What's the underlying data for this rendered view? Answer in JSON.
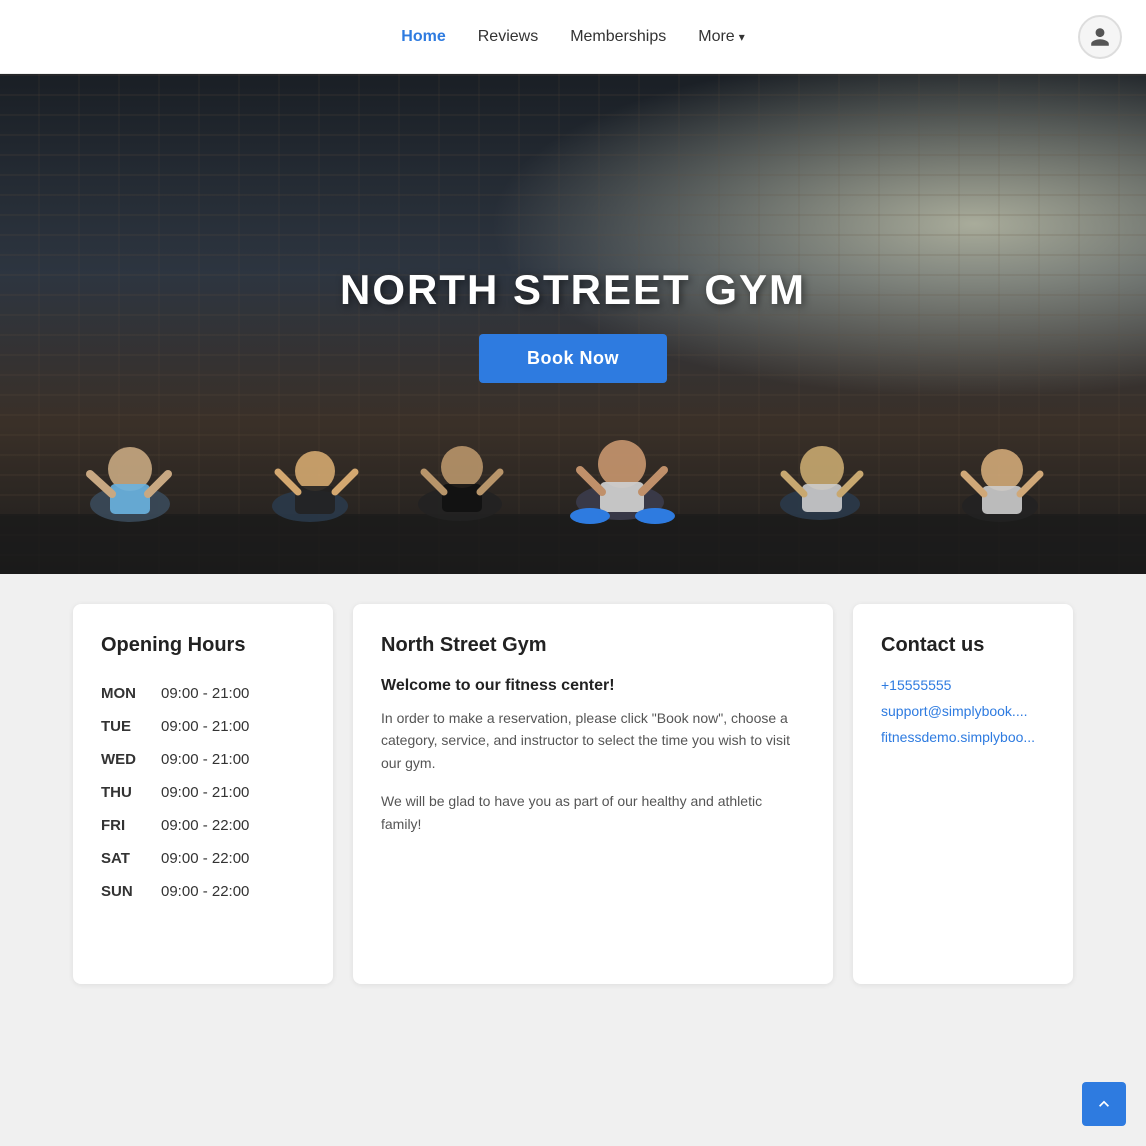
{
  "header": {
    "nav": [
      {
        "label": "Home",
        "active": true
      },
      {
        "label": "Reviews",
        "active": false
      },
      {
        "label": "Memberships",
        "active": false
      },
      {
        "label": "More",
        "active": false,
        "hasDropdown": true
      }
    ]
  },
  "hero": {
    "title": "NORTH STREET GYM",
    "bookBtn": "Book Now"
  },
  "openingHours": {
    "title": "Opening Hours",
    "rows": [
      {
        "day": "MON",
        "hours": "09:00 - 21:00"
      },
      {
        "day": "TUE",
        "hours": "09:00 - 21:00"
      },
      {
        "day": "WED",
        "hours": "09:00 - 21:00"
      },
      {
        "day": "THU",
        "hours": "09:00 - 21:00"
      },
      {
        "day": "FRI",
        "hours": "09:00 - 22:00"
      },
      {
        "day": "SAT",
        "hours": "09:00 - 22:00"
      },
      {
        "day": "SUN",
        "hours": "09:00 - 22:00"
      }
    ]
  },
  "about": {
    "title": "North Street Gym",
    "subtitle": "Welcome to our fitness center!",
    "paragraphs": [
      "In order to make a reservation, please click \"Book now\", choose a category, service, and instructor to select the time you wish to visit our gym.",
      "We will be glad to have you as part of our healthy and athletic family!"
    ]
  },
  "contact": {
    "title": "Contact us",
    "phone": "+15555555",
    "email": "support@simplybook....",
    "website": "fitnessdemo.simplyboo..."
  }
}
